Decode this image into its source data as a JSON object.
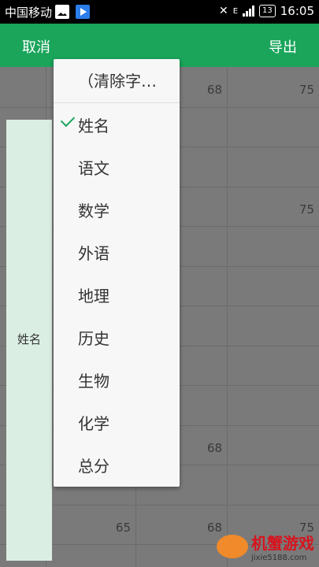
{
  "status": {
    "carrier": "中国移动",
    "network": "E",
    "battery": "13",
    "time": "16:05"
  },
  "toolbar": {
    "cancel_label": "取消",
    "export_label": "导出"
  },
  "sheet": {
    "cells": [
      {
        "row": 0,
        "col": 2,
        "value": "68"
      },
      {
        "row": 0,
        "col": 3,
        "value": "75"
      },
      {
        "row": 3,
        "col": 3,
        "value": "75"
      },
      {
        "row": 9,
        "col": 2,
        "value": "68"
      },
      {
        "row": 11,
        "col": 1,
        "value": "65"
      },
      {
        "row": 11,
        "col": 2,
        "value": "68"
      },
      {
        "row": 11,
        "col": 3,
        "value": "75"
      }
    ],
    "selected_column_label": "姓名"
  },
  "menu": {
    "items": [
      {
        "label": "（清除字…",
        "checked": false
      },
      {
        "label": "姓名",
        "checked": true
      },
      {
        "label": "语文",
        "checked": false
      },
      {
        "label": "数学",
        "checked": false
      },
      {
        "label": "外语",
        "checked": false
      },
      {
        "label": "地理",
        "checked": false
      },
      {
        "label": "历史",
        "checked": false
      },
      {
        "label": "生物",
        "checked": false
      },
      {
        "label": "化学",
        "checked": false
      },
      {
        "label": "总分",
        "checked": false
      }
    ]
  },
  "watermark": {
    "title": "机蟹游戏",
    "url": "jixie5188.com"
  }
}
